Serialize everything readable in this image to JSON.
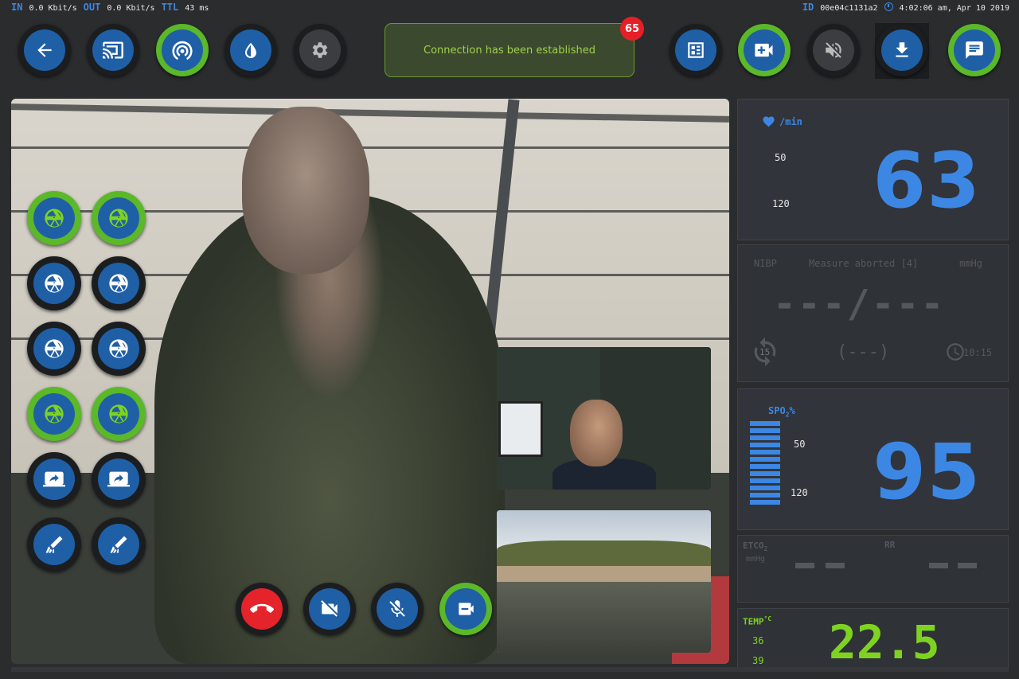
{
  "status": {
    "in_label": "IN",
    "in_value": "0.0 Kbit/s",
    "out_label": "OUT",
    "out_value": "0.0 Kbit/s",
    "ttl_label": "TTL",
    "ttl_value": "43 ms",
    "id_label": "ID",
    "id_value": "00e04c1131a2",
    "datetime": "4:02:06 am, Apr 10 2019"
  },
  "notification": {
    "message": "Connection has been established",
    "badge_count": "65"
  },
  "colors": {
    "accent_blue": "#3c87e3",
    "accent_green": "#5ab829",
    "alert_red": "#e61f26",
    "temp_green": "#7ed321"
  },
  "toolbar_left": [
    "back-icon",
    "cast-icon",
    "broadcast-icon",
    "water-drop-icon",
    "settings-gear-icon"
  ],
  "toolbar_right": [
    "dashboard-icon",
    "video-add-icon",
    "volume-muted-icon",
    "download-icon",
    "chat-icon"
  ],
  "side_buttons": [
    [
      "camera-shutter-icon",
      "camera-shutter-icon"
    ],
    [
      "camera-shutter-icon",
      "camera-shutter-icon"
    ],
    [
      "camera-shutter-icon",
      "camera-shutter-icon"
    ],
    [
      "camera-shutter-icon",
      "camera-shutter-icon"
    ],
    [
      "screen-share-icon",
      "screen-share-icon"
    ],
    [
      "ultrasound-probe-icon",
      "ultrasound-probe-icon"
    ]
  ],
  "call_controls": [
    "hang-up-icon",
    "video-off-icon",
    "mic-off-icon",
    "switch-camera-icon"
  ],
  "vitals": {
    "hr": {
      "unit": "/min",
      "low": "50",
      "high": "120",
      "value": "63"
    },
    "nibp": {
      "label": "NIBP",
      "status": "Measure aborted [4]",
      "unit": "mmHg",
      "value": "---/---",
      "mean": "(---)",
      "interval": "15",
      "time": "10:15"
    },
    "spo2": {
      "label_main": "SPO",
      "label_sub": "2",
      "label_suffix": "%",
      "low": "50",
      "high": "120",
      "value": "95",
      "bar_segments": 12
    },
    "etco2": {
      "label_main": "ETCO",
      "label_sub": "2",
      "unit": "mmHg",
      "rr_label": "RR"
    },
    "temp": {
      "label": "TEMP",
      "unit": "°C",
      "low": "36",
      "high": "39",
      "value": "22.5"
    }
  }
}
